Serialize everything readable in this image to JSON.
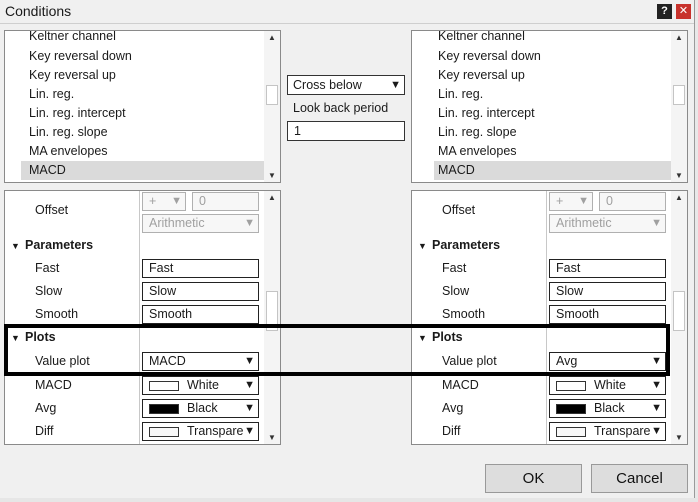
{
  "window": {
    "title": "Conditions",
    "help_label": "?",
    "close_label": "✕"
  },
  "colors": {
    "highlight": "#000000",
    "close": "#c8322c",
    "selected_row": "#dadada"
  },
  "left_list": {
    "items": [
      "Keltner channel",
      "Key reversal down",
      "Key reversal up",
      "Lin. reg.",
      "Lin. reg. intercept",
      "Lin. reg. slope",
      "MA envelopes",
      "MACD"
    ],
    "selected": "MACD"
  },
  "right_list": {
    "items": [
      "Keltner channel",
      "Key reversal down",
      "Key reversal up",
      "Lin. reg.",
      "Lin. reg. intercept",
      "Lin. reg. slope",
      "MA envelopes",
      "MACD"
    ],
    "selected": "MACD"
  },
  "middle": {
    "operator": "Cross below",
    "lookback_label": "Look back period",
    "lookback_value": "1"
  },
  "left_props": {
    "offset_label": "Offset",
    "offset_sign": "+",
    "offset_value": "0",
    "offset_mode": "Arithmetic",
    "parameters_header": "Parameters",
    "fast_label": "Fast",
    "fast_value": "Fast",
    "slow_label": "Slow",
    "slow_value": "Slow",
    "smooth_label": "Smooth",
    "smooth_value": "Smooth",
    "plots_header": "Plots",
    "value_plot_label": "Value plot",
    "value_plot_value": "MACD",
    "macd_label": "MACD",
    "macd_color": "White",
    "avg_label": "Avg",
    "avg_color": "Black",
    "diff_label": "Diff",
    "diff_color": "Transparent"
  },
  "right_props": {
    "offset_label": "Offset",
    "offset_sign": "+",
    "offset_value": "0",
    "offset_mode": "Arithmetic",
    "parameters_header": "Parameters",
    "fast_label": "Fast",
    "fast_value": "Fast",
    "slow_label": "Slow",
    "slow_value": "Slow",
    "smooth_label": "Smooth",
    "smooth_value": "Smooth",
    "plots_header": "Plots",
    "value_plot_label": "Value plot",
    "value_plot_value": "Avg",
    "macd_label": "MACD",
    "macd_color": "White",
    "avg_label": "Avg",
    "avg_color": "Black",
    "diff_label": "Diff",
    "diff_color": "Transparent"
  },
  "buttons": {
    "ok": "OK",
    "cancel": "Cancel"
  }
}
